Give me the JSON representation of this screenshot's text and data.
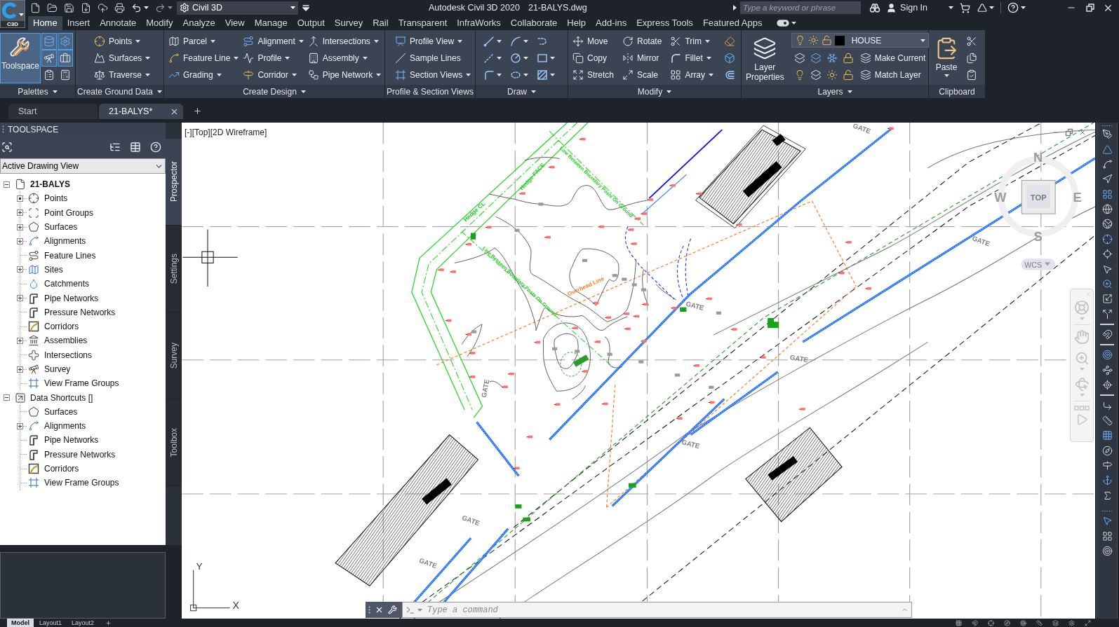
{
  "title_bar": {
    "app_badge": "C3D",
    "workspace": "Civil 3D",
    "title": "Autodesk Civil 3D 2020",
    "file": "21-BALYS.dwg",
    "search": {
      "placeholder": "Type a keyword or phrase"
    },
    "sign_in": "Sign In"
  },
  "ribbon_tabs": [
    {
      "label": "Home",
      "selected": true
    },
    {
      "label": "Insert",
      "selected": false
    },
    {
      "label": "Annotate",
      "selected": false
    },
    {
      "label": "Modify",
      "selected": false
    },
    {
      "label": "Analyze",
      "selected": false
    },
    {
      "label": "View",
      "selected": false
    },
    {
      "label": "Manage",
      "selected": false
    },
    {
      "label": "Output",
      "selected": false
    },
    {
      "label": "Survey",
      "selected": false
    },
    {
      "label": "Rail",
      "selected": false
    },
    {
      "label": "Transparent",
      "selected": false
    },
    {
      "label": "InfraWorks",
      "selected": false
    },
    {
      "label": "Collaborate",
      "selected": false
    },
    {
      "label": "Help",
      "selected": false
    },
    {
      "label": "Add-ins",
      "selected": false
    },
    {
      "label": "Express Tools",
      "selected": false
    },
    {
      "label": "Featured Apps",
      "selected": false
    }
  ],
  "ribbon_panels": [
    {
      "title": "Palettes",
      "menu": true,
      "columns": [
        [
          {
            "kind": "large",
            "label": "Toolspace",
            "selected": true,
            "menu": false
          }
        ],
        [
          {
            "kind": "icon",
            "selected": true,
            "menu": false
          },
          {
            "kind": "icon",
            "selected": true,
            "menu": false
          },
          {
            "kind": "icon",
            "selected": false,
            "menu": false
          }
        ],
        [
          {
            "kind": "icon",
            "selected": true,
            "menu": false
          },
          {
            "kind": "icon",
            "selected": true,
            "menu": false
          },
          {
            "kind": "icon",
            "selected": false,
            "menu": false
          }
        ]
      ]
    },
    {
      "title": "Create Ground Data",
      "menu": true,
      "columns": [
        [
          {
            "kind": "small",
            "label": "Points",
            "menu": true
          },
          {
            "kind": "small",
            "label": "Surfaces",
            "menu": true
          },
          {
            "kind": "small",
            "label": "Traverse",
            "menu": true
          }
        ]
      ]
    },
    {
      "title": "Create Design",
      "menu": true,
      "columns": [
        [
          {
            "kind": "small",
            "label": "Parcel",
            "menu": true
          },
          {
            "kind": "small",
            "label": "Feature Line",
            "menu": true
          },
          {
            "kind": "small",
            "label": "Grading",
            "menu": true
          }
        ],
        [
          {
            "kind": "small",
            "label": "Alignment",
            "menu": true
          },
          {
            "kind": "small",
            "label": "Profile",
            "menu": true
          },
          {
            "kind": "small",
            "label": "Corridor",
            "menu": true
          }
        ],
        [
          {
            "kind": "small",
            "label": "Intersections",
            "menu": true
          },
          {
            "kind": "small",
            "label": "Assembly",
            "menu": true
          },
          {
            "kind": "small",
            "label": "Pipe Network",
            "menu": true
          }
        ]
      ]
    },
    {
      "title": "Profile & Section Views",
      "menu": false,
      "columns": [
        [
          {
            "kind": "small",
            "label": "Profile View",
            "menu": true
          },
          {
            "kind": "small",
            "label": "Sample Lines",
            "menu": false
          },
          {
            "kind": "small",
            "label": "Section Views",
            "menu": true
          }
        ]
      ]
    },
    {
      "title": "Draw",
      "menu": true,
      "columns": [
        [
          {
            "kind": "icon",
            "menu": true
          },
          {
            "kind": "icon",
            "menu": true
          },
          {
            "kind": "icon",
            "menu": true
          }
        ],
        [
          {
            "kind": "icon",
            "menu": true
          },
          {
            "kind": "icon",
            "menu": true
          },
          {
            "kind": "icon",
            "menu": true
          }
        ],
        [
          {
            "kind": "icon",
            "menu": false
          },
          {
            "kind": "icon",
            "menu": true
          },
          {
            "kind": "icon",
            "menu": true
          }
        ]
      ]
    },
    {
      "title": "Modify",
      "menu": true,
      "columns": [
        [
          {
            "kind": "small",
            "label": "Move",
            "menu": false
          },
          {
            "kind": "small",
            "label": "Copy",
            "menu": false
          },
          {
            "kind": "small",
            "label": "Stretch",
            "menu": false
          }
        ],
        [
          {
            "kind": "small",
            "label": "Rotate",
            "menu": false
          },
          {
            "kind": "small",
            "label": "Mirror",
            "menu": false
          },
          {
            "kind": "small",
            "label": "Scale",
            "menu": false
          }
        ],
        [
          {
            "kind": "small",
            "label": "Trim",
            "menu": true
          },
          {
            "kind": "small",
            "label": "Fillet",
            "menu": true
          },
          {
            "kind": "small",
            "label": "Array",
            "menu": true
          }
        ],
        [
          {
            "kind": "icon",
            "menu": false
          },
          {
            "kind": "icon",
            "menu": false
          },
          {
            "kind": "icon",
            "menu": false
          }
        ]
      ]
    },
    {
      "title": "Layers",
      "menu": true,
      "columns": [
        [
          {
            "kind": "large",
            "label": "Layer Properties"
          }
        ],
        [
          {
            "kind": "layer_select",
            "value": "HOUSE"
          },
          {
            "kind": "strip",
            "label": "Make Current"
          },
          {
            "kind": "strip",
            "label": "Match Layer"
          }
        ]
      ]
    },
    {
      "title": "Clipboard",
      "menu": false,
      "columns": [
        [
          {
            "kind": "large",
            "label": "Paste",
            "menu": true
          }
        ],
        [
          {
            "kind": "icon",
            "menu": false
          },
          {
            "kind": "icon",
            "menu": false
          },
          {
            "kind": "icon",
            "menu": false
          }
        ]
      ]
    }
  ],
  "doc_tabs": [
    {
      "label": "Start",
      "selected": false,
      "closable": false
    },
    {
      "label": "21-BALYS*",
      "selected": true,
      "closable": true
    }
  ],
  "toolspace": {
    "title": "TOOLSPACE",
    "view_select": "Active Drawing View",
    "tree": [
      {
        "label": "21-BALYS",
        "expanded": true,
        "current": true,
        "children": [
          {
            "label": "Points",
            "expandable": true,
            "marked": true
          },
          {
            "label": "Point Groups",
            "expandable": true,
            "expanded": false,
            "marked": false
          },
          {
            "label": "Surfaces",
            "expandable": true,
            "expanded": false,
            "marked": false
          },
          {
            "label": "Alignments",
            "expandable": true,
            "expanded": false,
            "marked": false
          },
          {
            "label": "Feature Lines",
            "expandable": false
          },
          {
            "label": "Sites",
            "expandable": true,
            "expanded": false,
            "marked": false
          },
          {
            "label": "Catchments",
            "expandable": false
          },
          {
            "label": "Pipe Networks",
            "expandable": true,
            "expanded": false,
            "marked": false
          },
          {
            "label": "Pressure Networks",
            "expandable": false
          },
          {
            "label": "Corridors",
            "expandable": false
          },
          {
            "label": "Assemblies",
            "expandable": true,
            "expanded": false,
            "marked": false
          },
          {
            "label": "Intersections",
            "expandable": false
          },
          {
            "label": "Survey",
            "expandable": true,
            "expanded": false,
            "marked": false
          },
          {
            "label": "View Frame Groups",
            "expandable": false
          }
        ]
      },
      {
        "label": "Data Shortcuts []",
        "expanded": true,
        "current": false,
        "children": [
          {
            "label": "Surfaces",
            "expandable": false
          },
          {
            "label": "Alignments",
            "expandable": true,
            "expanded": false,
            "marked": false
          },
          {
            "label": "Pipe Networks",
            "expandable": false
          },
          {
            "label": "Pressure Networks",
            "expandable": false
          },
          {
            "label": "Corridors",
            "expandable": false
          },
          {
            "label": "View Frame Groups",
            "expandable": false
          }
        ]
      }
    ],
    "side_tabs": [
      {
        "label": "Prospector",
        "selected": true
      },
      {
        "label": "Settings",
        "selected": false
      },
      {
        "label": "Survey",
        "selected": false
      },
      {
        "label": "Toolbox",
        "selected": false
      }
    ]
  },
  "viewport": {
    "label": "[-][Top][2D Wireframe]",
    "annotations": [
      {
        "text": "Hedge CL",
        "color": "#22cc22"
      },
      {
        "text": "Hedge FACE",
        "color": "#22cc22"
      },
      {
        "text": "Line Between Boundary Posts On Ground",
        "color": "#22cc22"
      },
      {
        "text": "Line Between Boundary Posts On Ground",
        "color": "#22cc22"
      },
      {
        "text": "Overhead Line",
        "color": "#ff7f27"
      },
      {
        "text": "GATE",
        "color": "#808080"
      },
      {
        "text": "GATE",
        "color": "#808080"
      },
      {
        "text": "GATE",
        "color": "#808080"
      },
      {
        "text": "GATE",
        "color": "#808080"
      },
      {
        "text": "GATE",
        "color": "#808080"
      },
      {
        "text": "GATE",
        "color": "#808080"
      },
      {
        "text": "GATE",
        "color": "#808080"
      },
      {
        "text": "GATE",
        "color": "#808080"
      }
    ],
    "viewcube": {
      "north": "N",
      "east": "E",
      "south": "S",
      "west": "W",
      "face": "TOP",
      "coordinate_system": "WCS"
    },
    "ucs_icon": {
      "y_label": "Y",
      "x_label": "X"
    },
    "command_line": {
      "placeholder": "Type a command"
    }
  },
  "layout_tabs": [
    {
      "label": "Model",
      "selected": true
    },
    {
      "label": "Layout1",
      "selected": false
    },
    {
      "label": "Layout2",
      "selected": false
    }
  ]
}
